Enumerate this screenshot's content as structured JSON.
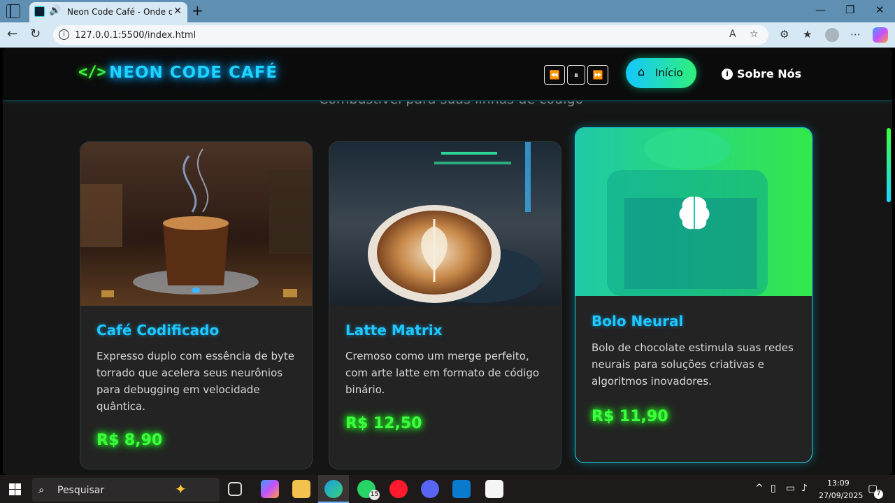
{
  "browser": {
    "tab_title": "Neon Code Café - Onde o Código",
    "url": "127.0.0.1:5500/index.html"
  },
  "site": {
    "logo_icon": "</>",
    "logo_text": "NEON CODE CAFÉ",
    "media_controls": [
      "⏪",
      "⏸",
      "⏩"
    ],
    "nav": {
      "home_label": "Início",
      "about_label": "Sobre Nós"
    },
    "subtitle": "Combustível para suas linhas de código"
  },
  "products": [
    {
      "title": "Café Codificado",
      "description": "Expresso duplo com essência de byte torrado que acelera seus neurônios para debugging em velocidade quântica.",
      "price": "R$ 8,90",
      "image_icon": "coffee-cup-photo"
    },
    {
      "title": "Latte Matrix",
      "description": "Cremoso como um merge perfeito, com arte latte em formato de código binário.",
      "price": "R$ 12,50",
      "image_icon": "latte-art-photo"
    },
    {
      "title": "Bolo Neural",
      "description": "Bolo de chocolate estimula suas redes neurais para soluções criativas e algoritmos inovadores.",
      "price": "R$ 11,90",
      "image_icon": "brain-icon"
    }
  ],
  "taskbar": {
    "search_placeholder": "Pesquisar",
    "whatsapp_badge": "15",
    "time": "13:09",
    "date": "27/09/2025",
    "notifications": "7"
  },
  "colors": {
    "neon_blue": "#1fd3ff",
    "neon_green": "#3dff3d",
    "card_bg": "#232323",
    "page_bg": "#151515"
  }
}
